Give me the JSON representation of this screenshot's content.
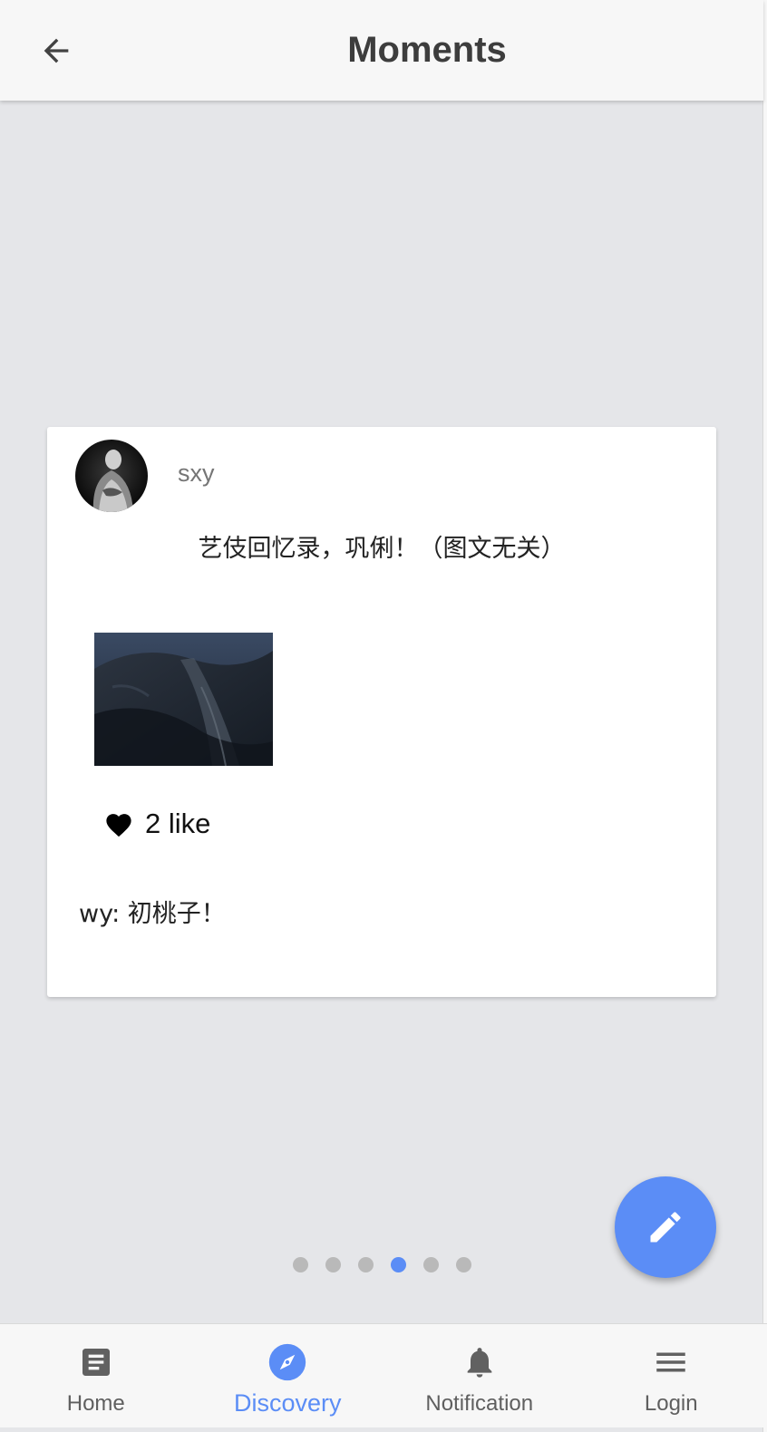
{
  "header": {
    "title": "Moments",
    "back_icon": "arrow-left-icon"
  },
  "post": {
    "username": "sxy",
    "text": "艺伎回忆录，巩俐！（图文无关）",
    "likes_label": "2 like",
    "comment": "wy: 初桃子！"
  },
  "pager": {
    "count": 6,
    "active_index": 3,
    "active_color": "#5b8df6",
    "inactive_color": "#b9b9b9"
  },
  "fab": {
    "icon": "pencil-icon",
    "color": "#5b8df6"
  },
  "bottom_nav": {
    "items": [
      {
        "label": "Home",
        "icon": "document-icon"
      },
      {
        "label": "Discovery",
        "icon": "compass-icon",
        "active": true
      },
      {
        "label": "Notification",
        "icon": "bell-icon"
      },
      {
        "label": "Login",
        "icon": "menu-icon"
      }
    ]
  }
}
